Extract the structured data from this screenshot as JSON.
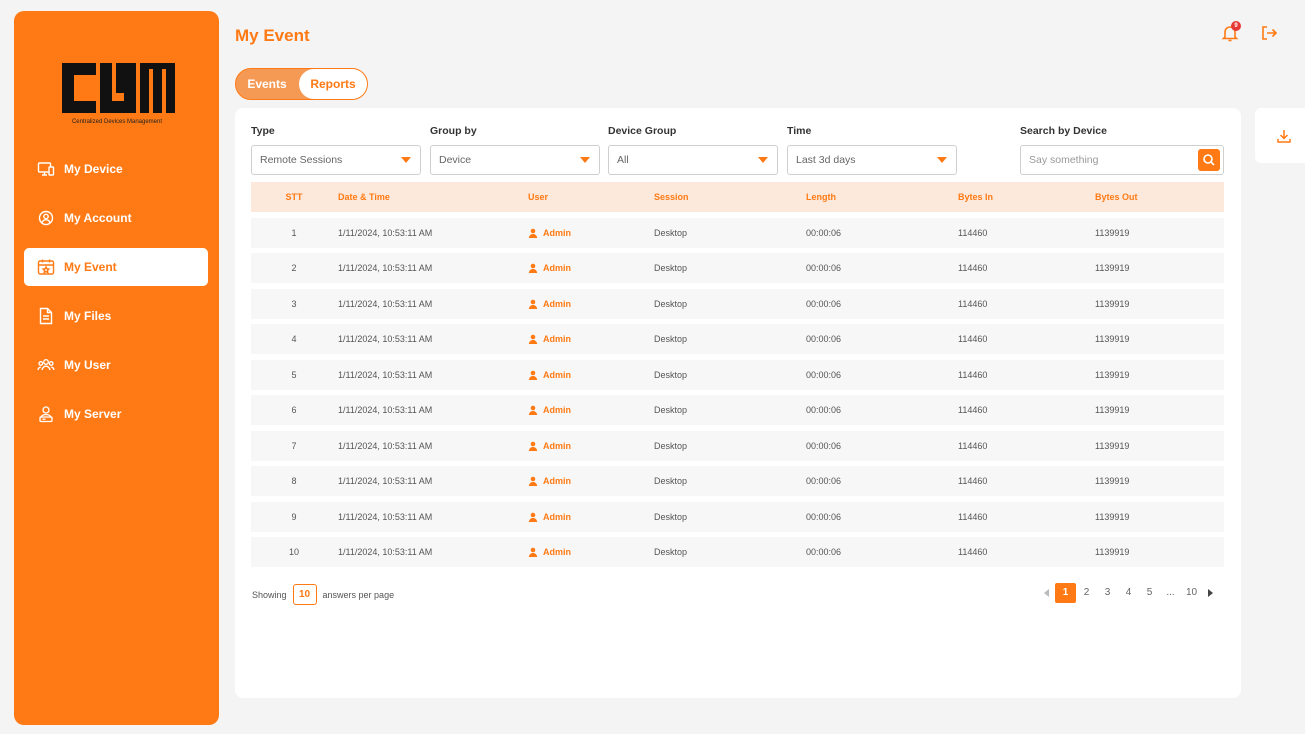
{
  "brand": {
    "logo_text": "CDM",
    "subtitle": "Centralized Devices Management"
  },
  "colors": {
    "accent": "#ff7a14",
    "header_row": "#fde9dc",
    "badge": "#e53935"
  },
  "sidebar": {
    "items": [
      {
        "label": "My Device",
        "icon": "device-icon"
      },
      {
        "label": "My Account",
        "icon": "gear-icon"
      },
      {
        "label": "My Event",
        "icon": "calendar-icon",
        "active": true
      },
      {
        "label": "My Files",
        "icon": "file-icon"
      },
      {
        "label": "My User",
        "icon": "users-icon"
      },
      {
        "label": "My Server",
        "icon": "server-icon"
      }
    ]
  },
  "header": {
    "title": "My Event",
    "notification_count": "9"
  },
  "tabs": [
    {
      "label": "Events"
    },
    {
      "label": "Reports",
      "active": true
    }
  ],
  "filters": {
    "type": {
      "label": "Type",
      "value": "Remote Sessions"
    },
    "group_by": {
      "label": "Group by",
      "value": "Device"
    },
    "device_group": {
      "label": "Device Group",
      "value": "All"
    },
    "time": {
      "label": "Time",
      "value": "Last 3d days"
    },
    "search": {
      "label": "Search by Device",
      "placeholder": "Say something"
    }
  },
  "table": {
    "columns": [
      "STT",
      "Date & Time",
      "User",
      "Session",
      "Length",
      "Bytes In",
      "Bytes Out"
    ],
    "rows": [
      [
        "1",
        "1/11/2024, 10:53:11 AM",
        "Admin",
        "Desktop",
        "00:00:06",
        "114460",
        "1139919"
      ],
      [
        "2",
        "1/11/2024, 10:53:11 AM",
        "Admin",
        "Desktop",
        "00:00:06",
        "114460",
        "1139919"
      ],
      [
        "3",
        "1/11/2024, 10:53:11 AM",
        "Admin",
        "Desktop",
        "00:00:06",
        "114460",
        "1139919"
      ],
      [
        "4",
        "1/11/2024, 10:53:11 AM",
        "Admin",
        "Desktop",
        "00:00:06",
        "114460",
        "1139919"
      ],
      [
        "5",
        "1/11/2024, 10:53:11 AM",
        "Admin",
        "Desktop",
        "00:00:06",
        "114460",
        "1139919"
      ],
      [
        "6",
        "1/11/2024, 10:53:11 AM",
        "Admin",
        "Desktop",
        "00:00:06",
        "114460",
        "1139919"
      ],
      [
        "7",
        "1/11/2024, 10:53:11 AM",
        "Admin",
        "Desktop",
        "00:00:06",
        "114460",
        "1139919"
      ],
      [
        "8",
        "1/11/2024, 10:53:11 AM",
        "Admin",
        "Desktop",
        "00:00:06",
        "114460",
        "1139919"
      ],
      [
        "9",
        "1/11/2024, 10:53:11 AM",
        "Admin",
        "Desktop",
        "00:00:06",
        "114460",
        "1139919"
      ],
      [
        "10",
        "1/11/2024, 10:53:11 AM",
        "Admin",
        "Desktop",
        "00:00:06",
        "114460",
        "1139919"
      ]
    ]
  },
  "footer": {
    "showing": "Showing",
    "per_page": "10",
    "per_page_suffix": "answers per page"
  },
  "pagination": {
    "pages": [
      "1",
      "2",
      "3",
      "4",
      "5",
      "...",
      "10"
    ],
    "current": "1"
  }
}
